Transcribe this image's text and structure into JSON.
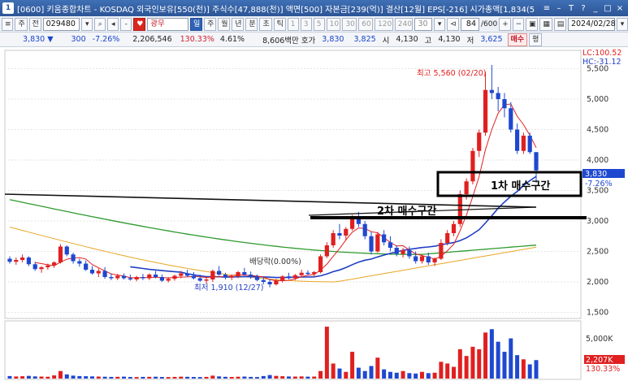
{
  "window": {
    "app_icon": "1",
    "title": "[0600] 키움종합차트 - KOSDAQ 외국인보유[550(천)] 주식수[47,888(천)] 액면[500] 자본금[239(억)] 결산[12월] EPS[-216] 시가총액[1,834(5",
    "controls": [
      "≡",
      "–",
      "T",
      "?",
      "_",
      "□",
      "×"
    ]
  },
  "toolbar": {
    "menu": "≡",
    "jugi": "주",
    "jeon": "전",
    "code": "029480",
    "company": "광무",
    "periods": [
      "일",
      "주",
      "월",
      "년",
      "분",
      "초",
      "틱"
    ],
    "active_period": "일",
    "minutes": [
      "1",
      "3",
      "5",
      "10",
      "30",
      "60",
      "120",
      "240"
    ],
    "n_value": "30",
    "count": "84",
    "count_total": "/600",
    "date": "2024/02/28"
  },
  "quote": {
    "price": "3,830",
    "arrow": "▼",
    "change": "300",
    "change_pct": "-7.26%",
    "volume": "2,206,546",
    "volume_ratio": "130.33%",
    "turnover": "4.61%",
    "amount": "8,606백만",
    "ask_label": "호가",
    "ask": "3,830",
    "bid": "3,825",
    "open_label": "시",
    "open": "4,130",
    "high_label": "고",
    "high": "4,130",
    "low_label": "저",
    "low": "3,625",
    "buy_button": "매수",
    "eval_button": "평"
  },
  "chart": {
    "lc_label": "LC:100.52",
    "hc_label": "HC:-31.12",
    "price_ticks": [
      "5,500",
      "5,000",
      "4,500",
      "4,000",
      "3,500",
      "3,000",
      "2,500",
      "2,000",
      "1,500"
    ],
    "volume_tick": "5,000K",
    "current_price_tag": "3,830",
    "current_pct_tag": "-7.26%",
    "volume_tag": "2,207K",
    "volume_pct_tag": "130.33%",
    "high_marker": "최고 5,560 (02/20)",
    "low_marker": "최저 1,910 (12/27)",
    "dividend_marker": "배당락(0.00%)",
    "zone1_label": "1차 매수구간",
    "zone2_label": "2차 매수구간",
    "colors": {
      "up": "#e02020",
      "down": "#1f48d0",
      "ma5": "#e02020",
      "ma20": "#1f3fc4",
      "ma60": "#2e9a2e",
      "ma120": "#e8a624",
      "trend": "#111111"
    }
  },
  "chart_data": {
    "type": "candlestick",
    "y_range": [
      1400,
      5800
    ],
    "candles": [
      [
        2380,
        2420,
        2300,
        2330
      ],
      [
        2330,
        2400,
        2280,
        2360
      ],
      [
        2360,
        2450,
        2320,
        2400
      ],
      [
        2400,
        2420,
        2260,
        2290
      ],
      [
        2290,
        2330,
        2180,
        2210
      ],
      [
        2210,
        2260,
        2150,
        2240
      ],
      [
        2240,
        2300,
        2200,
        2270
      ],
      [
        2270,
        2340,
        2230,
        2320
      ],
      [
        2320,
        2620,
        2300,
        2580
      ],
      [
        2580,
        2600,
        2420,
        2450
      ],
      [
        2450,
        2480,
        2300,
        2340
      ],
      [
        2340,
        2380,
        2250,
        2300
      ],
      [
        2300,
        2350,
        2180,
        2200
      ],
      [
        2200,
        2260,
        2120,
        2140
      ],
      [
        2140,
        2220,
        2080,
        2180
      ],
      [
        2180,
        2240,
        2050,
        2080
      ],
      [
        2080,
        2140,
        2030,
        2060
      ],
      [
        2060,
        2130,
        2030,
        2100
      ],
      [
        2100,
        2140,
        2040,
        2060
      ],
      [
        2060,
        2120,
        2020,
        2040
      ],
      [
        2040,
        2100,
        2010,
        2080
      ],
      [
        2080,
        2130,
        2030,
        2060
      ],
      [
        2060,
        2140,
        2030,
        2120
      ],
      [
        2120,
        2180,
        2060,
        2080
      ],
      [
        2080,
        2120,
        2000,
        2020
      ],
      [
        2020,
        2080,
        1990,
        2050
      ],
      [
        2050,
        2120,
        2020,
        2100
      ],
      [
        2100,
        2180,
        2060,
        2140
      ],
      [
        2140,
        2200,
        2080,
        2100
      ],
      [
        2100,
        2160,
        2040,
        2060
      ],
      [
        2060,
        2120,
        2000,
        2020
      ],
      [
        2020,
        2080,
        1970,
        2040
      ],
      [
        2040,
        2200,
        2000,
        2180
      ],
      [
        2180,
        2260,
        2100,
        2120
      ],
      [
        2120,
        2150,
        2040,
        2070
      ],
      [
        2070,
        2120,
        2030,
        2090
      ],
      [
        2090,
        2180,
        2060,
        2160
      ],
      [
        2160,
        2230,
        2100,
        2120
      ],
      [
        2120,
        2170,
        2050,
        2080
      ],
      [
        2080,
        2120,
        2010,
        2030
      ],
      [
        2030,
        2080,
        1960,
        2000
      ],
      [
        2000,
        2050,
        1910,
        1960
      ],
      [
        1960,
        2050,
        1940,
        2020
      ],
      [
        2020,
        2110,
        1990,
        2090
      ],
      [
        2090,
        2150,
        2040,
        2060
      ],
      [
        2060,
        2130,
        2030,
        2110
      ],
      [
        2110,
        2200,
        2080,
        2150
      ],
      [
        2150,
        2190,
        2100,
        2130
      ],
      [
        2130,
        2180,
        2080,
        2160
      ],
      [
        2160,
        2450,
        2140,
        2420
      ],
      [
        2420,
        2650,
        2390,
        2600
      ],
      [
        2600,
        2850,
        2560,
        2800
      ],
      [
        2800,
        2950,
        2700,
        2760
      ],
      [
        2760,
        2900,
        2680,
        2870
      ],
      [
        2870,
        3100,
        2840,
        3050
      ],
      [
        3050,
        3150,
        2900,
        2950
      ],
      [
        2950,
        3000,
        2700,
        2750
      ],
      [
        2750,
        2820,
        2450,
        2500
      ],
      [
        2500,
        2820,
        2480,
        2780
      ],
      [
        2780,
        2850,
        2600,
        2650
      ],
      [
        2650,
        2750,
        2500,
        2560
      ],
      [
        2560,
        2600,
        2420,
        2460
      ],
      [
        2460,
        2560,
        2400,
        2520
      ],
      [
        2520,
        2580,
        2380,
        2420
      ],
      [
        2420,
        2500,
        2300,
        2340
      ],
      [
        2340,
        2450,
        2300,
        2420
      ],
      [
        2420,
        2480,
        2280,
        2320
      ],
      [
        2320,
        2400,
        2260,
        2380
      ],
      [
        2380,
        2700,
        2360,
        2640
      ],
      [
        2640,
        2850,
        2600,
        2800
      ],
      [
        2800,
        3000,
        2750,
        2950
      ],
      [
        2950,
        3500,
        2900,
        3440
      ],
      [
        3440,
        3700,
        3350,
        3650
      ],
      [
        3650,
        4200,
        3600,
        4150
      ],
      [
        4150,
        4500,
        4050,
        4450
      ],
      [
        4450,
        5450,
        4400,
        5150
      ],
      [
        5150,
        5560,
        5000,
        5100
      ],
      [
        5100,
        5200,
        4800,
        5000
      ],
      [
        5000,
        5100,
        4700,
        4850
      ],
      [
        4850,
        4950,
        4450,
        4500
      ],
      [
        4500,
        4600,
        4100,
        4150
      ],
      [
        4150,
        4450,
        4100,
        4400
      ],
      [
        4400,
        4450,
        4100,
        4130
      ],
      [
        4130,
        4130,
        3625,
        3830
      ]
    ],
    "volumes_k": [
      300,
      250,
      280,
      320,
      260,
      240,
      220,
      380,
      900,
      500,
      350,
      300,
      280,
      260,
      240,
      220,
      200,
      210,
      230,
      190,
      180,
      200,
      210,
      220,
      190,
      180,
      200,
      230,
      210,
      190,
      180,
      200,
      350,
      260,
      210,
      190,
      220,
      240,
      200,
      180,
      300,
      420,
      320,
      280,
      250,
      240,
      260,
      230,
      240,
      900,
      6200,
      1800,
      1200,
      800,
      3200,
      1300,
      900,
      1500,
      2500,
      1100,
      800,
      700,
      900,
      650,
      600,
      800,
      650,
      700,
      2000,
      1800,
      1400,
      3500,
      2700,
      3800,
      3500,
      5500,
      5900,
      4400,
      3200,
      4800,
      2800,
      2300,
      1700,
      2207
    ]
  }
}
